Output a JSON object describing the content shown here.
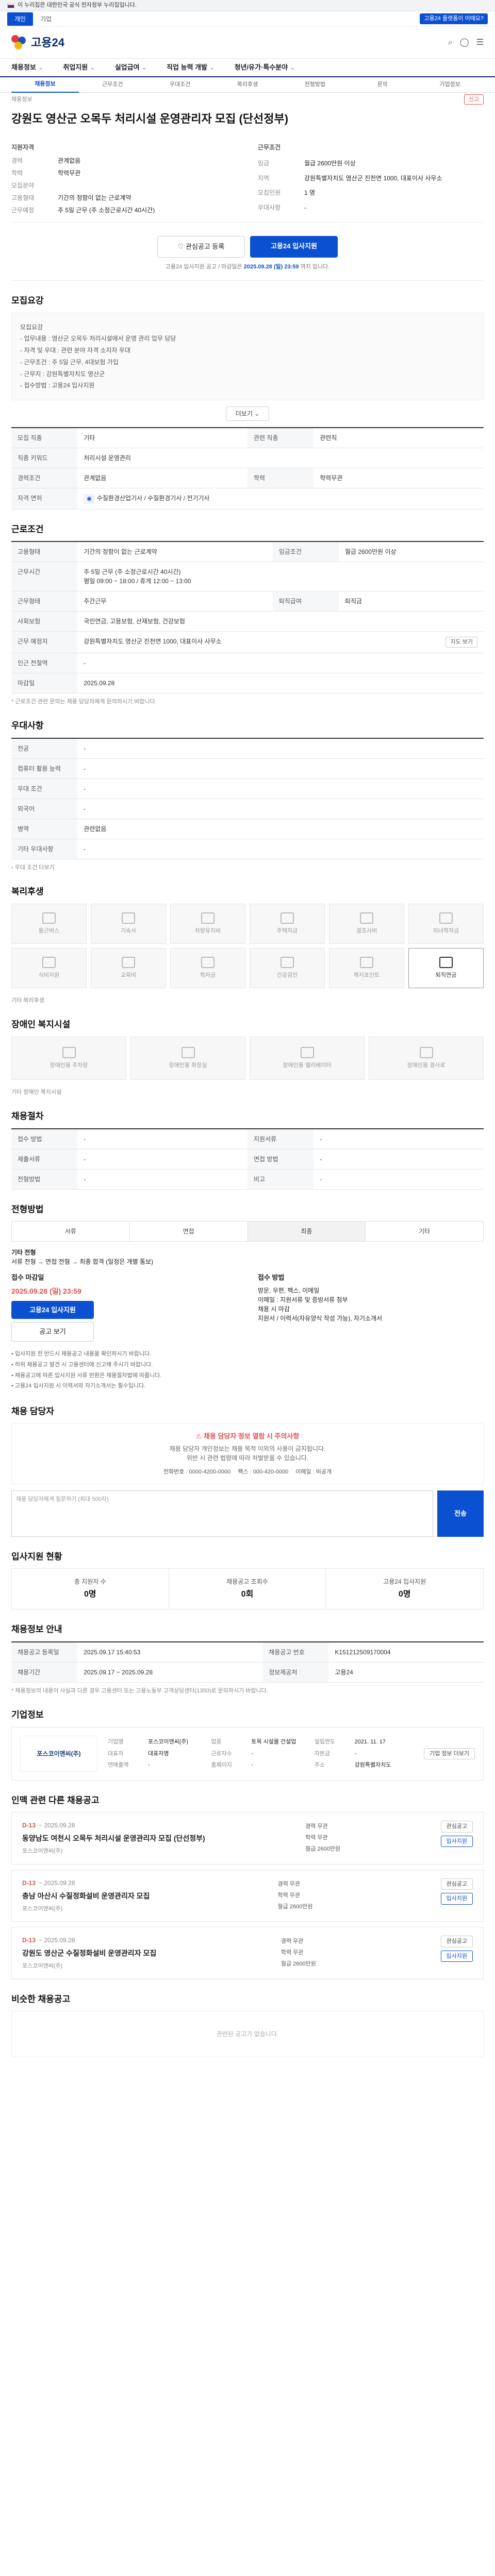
{
  "topbar": {
    "notice": "이 누리집은 대한민국 공식 전자정부 누리집입니다."
  },
  "govbar": {
    "tabs": [
      "개인",
      "기업"
    ],
    "badge": "고용24 플랫폼이 어때요?"
  },
  "header": {
    "logo": "고용24"
  },
  "gnb": [
    "채용정보",
    "취업지원",
    "실업급여",
    "직업 능력 개발",
    "청년/유가·특수분야"
  ],
  "subtabs": [
    "채용정보",
    "근무조건",
    "우대조건",
    "복리후생",
    "전형방법",
    "문의",
    "기업정보"
  ],
  "crumb": {
    "left": "채용정보",
    "report": "신고"
  },
  "job": {
    "title": "강원도 영산군 오목두 처리시설 운영관리자 모집 (단선정부)"
  },
  "summary": {
    "left_head": "지원자격",
    "right_head": "근무조건",
    "left": [
      {
        "k": "경력",
        "v": "관계없음"
      },
      {
        "k": "학력",
        "v": "학력무관"
      },
      {
        "k": "",
        "v": ""
      },
      {
        "k": "모집분야",
        "v": ""
      },
      {
        "k": "고용형태",
        "v": "기간의 정함이 없는 근로계약"
      },
      {
        "k": "근무예정",
        "v": "주 5일 근무 (주 소정근로시간 40시간)"
      }
    ],
    "right": [
      {
        "k": "임금",
        "v": "월급 2600만원 이상"
      },
      {
        "k": "지역",
        "v": "강원특별자치도 영산군 진천면 1000, 대표이사 사무소"
      },
      {
        "k": "",
        "v": ""
      },
      {
        "k": "모집인원",
        "v": "1 명"
      },
      {
        "k": "우대사항",
        "v": "-"
      },
      {
        "k": "",
        "v": ""
      }
    ]
  },
  "cta": {
    "save": "관심공고 등록",
    "apply": "고용24 입사지원",
    "note_pre": "고용24 입사지원 공고 / 마감일은",
    "note_b": "2025.09.28 (일) 23:59",
    "note_post": "까지 입니다."
  },
  "sections": {
    "recruit": "모집요강",
    "conditions": "근로조건",
    "pref": "우대사항",
    "welfare": "복리후생",
    "disability": "장애인 복지시설",
    "jobseeker": "채용절차",
    "process": "전형방법",
    "contact": "채용 담당자",
    "stats": "입사지원 현황",
    "info": "채용정보 안내",
    "company": "기업정보",
    "other_jobs": "인맥 관련 다른 채용공고",
    "related": "비슷한 채용공고"
  },
  "recruit": {
    "notice": [
      "모집요강",
      "- 업무내용 : 영산군 오목두 처리시설에서 운영 관리 업무 담당",
      "- 자격 및 우대 : 관련 분야 자격 소지자 우대",
      "- 근무조건 : 주 5일 근무, 4대보험 가입",
      "- 근무지 : 강원특별자치도 영산군",
      "- 접수방법 : 고용24 입사지원"
    ],
    "more": "더보기 ⌄",
    "rows": [
      {
        "k": "모집 직종",
        "v": "기타"
      },
      {
        "k": "관련 직종",
        "v": "관련직"
      },
      {
        "k": "직종 키워드",
        "v": "처리시설 운영관리"
      },
      {
        "k": "경력조건",
        "v": "관계없음"
      },
      {
        "k": "학력",
        "v": "학력무관"
      },
      {
        "k": "자격 면허",
        "v": "수질환경산업기사 / 수질환경기사 / 전기기사"
      }
    ]
  },
  "conditions": {
    "rows": [
      {
        "k": "고용형태",
        "v": "기간의 정함이 없는 근로계약"
      },
      {
        "k": "임금조건",
        "v": "월급 2600만원 이상"
      },
      {
        "k": "근무시간",
        "v": "주 5일 근무 (주 소정근로시간 40시간)"
      },
      {
        "k": "근무시간 상세",
        "v": "평일 09:00 ~ 18:00 / 휴게 12:00 ~ 13:00"
      },
      {
        "k": "근무형태",
        "v": "주간근무"
      },
      {
        "k": "사회보험",
        "v": "국민연금, 고용보험, 산재보험, 건강보험"
      },
      {
        "k": "퇴직급여",
        "v": "퇴직금"
      },
      {
        "k": "근무 예정지",
        "v": "강원특별자치도 영산군 진천면 1000, 대표이사 사무소"
      },
      {
        "k": "인근 전철역",
        "v": "-"
      },
      {
        "k": "마감일",
        "v": "2025.09.28"
      }
    ],
    "map_btn": "지도 보기",
    "note": "* 근로조건 관련 문의는 채용 담당자에게 문의하시기 바랍니다."
  },
  "pref": {
    "rows": [
      {
        "k": "전공",
        "v": "-"
      },
      {
        "k": "컴퓨터 활용 능력",
        "v": "-"
      },
      {
        "k": "우대 조건",
        "v": "-"
      },
      {
        "k": "외국어",
        "v": "-"
      },
      {
        "k": "병역",
        "v": "관련없음"
      },
      {
        "k": "기타 우대사항",
        "v": "-"
      }
    ]
  },
  "welfare": {
    "cards": [
      "통근버스",
      "기숙사",
      "차량유지비",
      "주택자금",
      "경조사비",
      "자녀학자금",
      "식비지원",
      "교육비",
      "학자금",
      "건강검진",
      "복지포인트",
      "퇴직연금"
    ],
    "note": "기타 복리후생"
  },
  "disability": {
    "cards": [
      "장애인용 주차장",
      "장애인용 화장실",
      "장애인용 엘리베이터",
      "장애인용 경사로"
    ],
    "note": "기타 장애인 복지시설"
  },
  "jobseeker": {
    "rows": [
      {
        "k": "접수 방법",
        "v": "-"
      },
      {
        "k": "지원서류",
        "v": "-"
      },
      {
        "k": "제출서류",
        "v": "-"
      },
      {
        "k": "면접 방법",
        "v": "-"
      },
      {
        "k": "전형방법",
        "v": "-"
      },
      {
        "k": "비고",
        "v": "-"
      }
    ]
  },
  "process": {
    "tabs": [
      "서류",
      "면접",
      "최종",
      "기타"
    ],
    "method_label": "기타 전형",
    "method_text": "서류 전형 → 면접 전형 → 최종 합격 (일정은 개별 통보)"
  },
  "apply": {
    "left_title": "접수 마감일",
    "date": "2025.09.28 (일) 23:59",
    "btn1": "고용24 입사지원",
    "btn2": "공고 보기",
    "right_title": "접수 방법",
    "right_lines": [
      "방문, 우편, 팩스, 이메일",
      "이메일 : 지원서류 및 증빙서류 첨부",
      "채용 시 마감",
      "지원서 / 이력서(자유양식 작성 가능), 자기소개서"
    ]
  },
  "notices": [
    "입사지원 전 반드시 채용공고 내용을 확인하시기 바랍니다.",
    "허위 채용공고 발견 시 고용센터에 신고해 주시기 바랍니다.",
    "채용공고에 따른 입사지원 서류 반환은 채용절차법에 따릅니다.",
    "고용24 입사지원 시 이력서와 자기소개서는 필수입니다."
  ],
  "contact": {
    "warn": "채용 담당자 정보 열람 시 주의사항",
    "lines": [
      "채용 담당자 개인정보는 채용 목적 이외의 사용이 금지됩니다.",
      "위반 시 관련 법령에 따라 처벌받을 수 있습니다."
    ],
    "phone": "전화번호 : 0000-4200-0000",
    "fax": "팩스 : 000-420-0000",
    "email": "이메일 : 비공개",
    "q_placeholder": "채용 담당자에게 질문하기 (최대 500자)",
    "send": "전송"
  },
  "stats": [
    {
      "k": "총 지원자 수",
      "v": "0명"
    },
    {
      "k": "채용공고 조회수",
      "v": "0회"
    },
    {
      "k": "고용24 입사지원",
      "v": "0명"
    }
  ],
  "info": {
    "rows": [
      {
        "k": "채용공고 등록일",
        "v": "2025.09.17 15:40:53"
      },
      {
        "k": "채용기간",
        "v": "2025.09.17 ~ 2025.09.28"
      },
      {
        "k": "채용공고 번호",
        "v": "K151212509170004"
      },
      {
        "k": "정보제공처",
        "v": "고용24"
      }
    ],
    "note": "* 채용정보의 내용이 사실과 다른 경우 고용센터 또는 고용노동부 고객상담센터(1350)로 문의하시기 바랍니다."
  },
  "company": {
    "logo": "포스코이앤씨(주)",
    "rows": [
      {
        "k": "기업명",
        "v": "포스코이앤씨(주)"
      },
      {
        "k": "업종",
        "v": "토목 시설물 건설업"
      },
      {
        "k": "설립연도",
        "v": "2021. 11. 17"
      },
      {
        "k": "대표자",
        "v": "대표자명"
      },
      {
        "k": "근로자수",
        "v": "-"
      },
      {
        "k": "자본금",
        "v": "-"
      },
      {
        "k": "연매출액",
        "v": "-"
      },
      {
        "k": "홈페이지",
        "v": "-"
      },
      {
        "k": "주소",
        "v": "강원특별자치도"
      }
    ],
    "more": "기업 정보 더보기"
  },
  "other_jobs": [
    {
      "dday": "D-13",
      "date": "~ 2025.09.28",
      "title": "동양남도 여천시 오목두 처리시설 운영관리자 모집 (단선정부)",
      "meta": "포스코이앤씨(주)",
      "info": [
        "경력 무관",
        "학력 무관",
        "월급 2600만원"
      ],
      "btn1": "관심공고",
      "btn2": "입사지원"
    },
    {
      "dday": "D-13",
      "date": "~ 2025.09.28",
      "title": "충남 아산시 수질정화설비 운영관리자 모집",
      "meta": "포스코이앤씨(주)",
      "info": [
        "경력 무관",
        "학력 무관",
        "월급 2600만원"
      ],
      "btn1": "관심공고",
      "btn2": "입사지원"
    },
    {
      "dday": "D-13",
      "date": "~ 2025.09.28",
      "title": "강원도 영산군 수질정화설비 운영관리자 모집",
      "meta": "포스코이앤씨(주)",
      "info": [
        "경력 무관",
        "학력 무관",
        "월급 2600만원"
      ],
      "btn1": "관심공고",
      "btn2": "입사지원"
    }
  ],
  "related_empty": "관련된 공고가 없습니다."
}
